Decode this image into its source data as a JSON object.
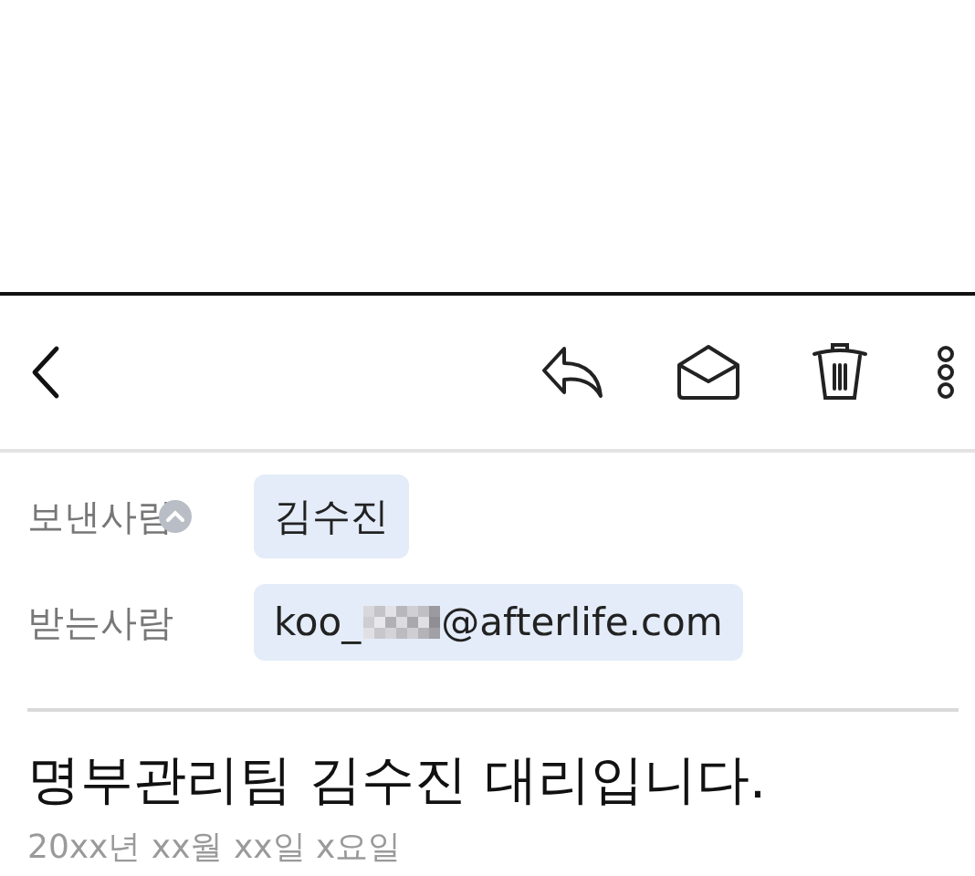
{
  "sender": {
    "label": "보낸사람",
    "collapsed": false,
    "name": "김수진"
  },
  "recipient": {
    "label": "받는사람",
    "address_start": "koo_",
    "redacted": true,
    "address_end": "@afterlife.com"
  },
  "subject": "명부관리팀 김수진 대리입니다.",
  "date": "20xx년 xx월 xx일 x요일"
}
